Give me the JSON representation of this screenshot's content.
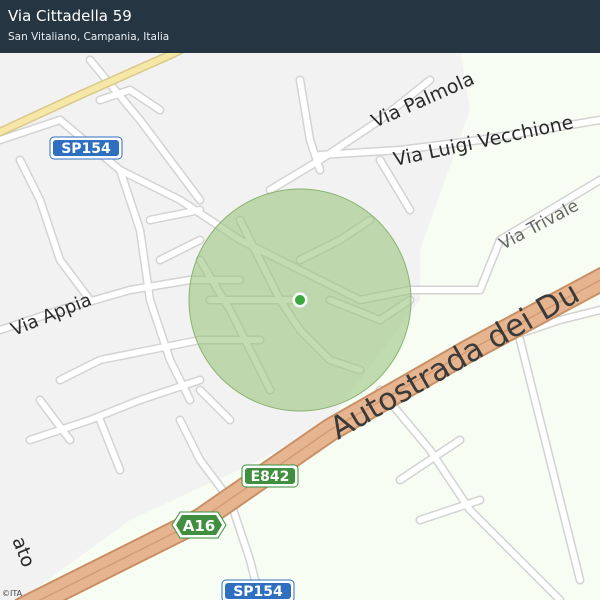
{
  "header": {
    "title": "Via Cittadella 59",
    "subtitle": "San Vitaliano, Campania, Italia"
  },
  "map": {
    "roads": {
      "via_palmola": "Via Palmola",
      "via_luigi_vecchione": "Via Luigi Vecchione",
      "via_trivale": "Via Trivale",
      "via_appia": "Via Appia",
      "autostrada": "Autostrada dei Du",
      "partial_label": "ato"
    },
    "shields": {
      "sp154_top": "SP154",
      "e842": "E842",
      "a16": "A16",
      "sp154_bottom": "SP154"
    },
    "colors": {
      "built_area": "#f2f2f2",
      "open_land": "#f7fdf2",
      "street": "#ffffff",
      "street_casing": "#d3d3d3",
      "motorway": "#d8a27b",
      "primary_road": "#f7e7a6",
      "accuracy_circle": "#9bc47f",
      "location_dot": "#3aa83a",
      "shield_blue": "#2f6fc0",
      "shield_green": "#3f8f3f"
    }
  },
  "attribution": "©ITA"
}
